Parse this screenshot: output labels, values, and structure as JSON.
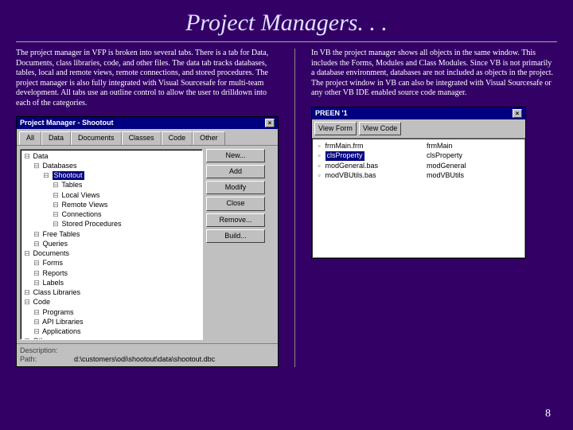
{
  "title": "Project Managers. . .",
  "pageNumber": "8",
  "left": {
    "para": "The project manager in VFP is broken into several tabs. There is a tab for Data, Documents, class libraries, code, and other files. The data tab  tracks databases, tables, local and remote views, remote connections, and stored procedures. The project manager is also fully integrated with Visual Sourcesafe for multi-team development. All tabs use an outline control to allow the user to drilldown into each of the categories."
  },
  "right": {
    "para": "In VB the project manager shows all objects in the same window. This includes the Forms, Modules and Class Modules.  Since VB is not primarily a database environment, databases are not included as objects in the project.  The project window in VB can also be integrated with Visual Sourcesafe or any other VB IDE enabled source code manager."
  },
  "vfp": {
    "windowTitle": "Project Manager - Shootout",
    "tabs": [
      "All",
      "Data",
      "Documents",
      "Classes",
      "Code",
      "Other"
    ],
    "activeTab": 0,
    "buttons": [
      "New...",
      "Add",
      "Modify",
      "Close",
      "Remove...",
      "Build..."
    ],
    "tree": [
      {
        "l": 0,
        "t": "Data"
      },
      {
        "l": 1,
        "t": "Databases"
      },
      {
        "l": 2,
        "t": "Shootout",
        "sel": true
      },
      {
        "l": 3,
        "t": "Tables"
      },
      {
        "l": 3,
        "t": "Local Views"
      },
      {
        "l": 3,
        "t": "Remote Views"
      },
      {
        "l": 3,
        "t": "Connections"
      },
      {
        "l": 3,
        "t": "Stored Procedures"
      },
      {
        "l": 1,
        "t": "Free Tables"
      },
      {
        "l": 1,
        "t": "Queries"
      },
      {
        "l": 0,
        "t": "Documents"
      },
      {
        "l": 1,
        "t": "Forms"
      },
      {
        "l": 1,
        "t": "Reports"
      },
      {
        "l": 1,
        "t": "Labels"
      },
      {
        "l": 0,
        "t": "Class Libraries"
      },
      {
        "l": 0,
        "t": "Code"
      },
      {
        "l": 1,
        "t": "Programs"
      },
      {
        "l": 1,
        "t": "API Libraries"
      },
      {
        "l": 1,
        "t": "Applications"
      },
      {
        "l": 0,
        "t": "Other"
      }
    ],
    "footer": {
      "descLabel": "Description:",
      "pathLabel": "Path:",
      "pathValue": "d:\\customers\\odi\\shootout\\data\\shootout.dbc"
    }
  },
  "vb": {
    "windowTitle": "PREEN '1",
    "buttons": [
      "View Form",
      "View Code"
    ],
    "items": [
      {
        "c1": "frmMain.frm",
        "c2": "frmMain"
      },
      {
        "c1": "clsProperty",
        "c2": "clsProperty",
        "sel": true
      },
      {
        "c1": "modGeneral.bas",
        "c2": "modGeneral"
      },
      {
        "c1": "modVBUtils.bas",
        "c2": "modVBUtils"
      }
    ]
  }
}
